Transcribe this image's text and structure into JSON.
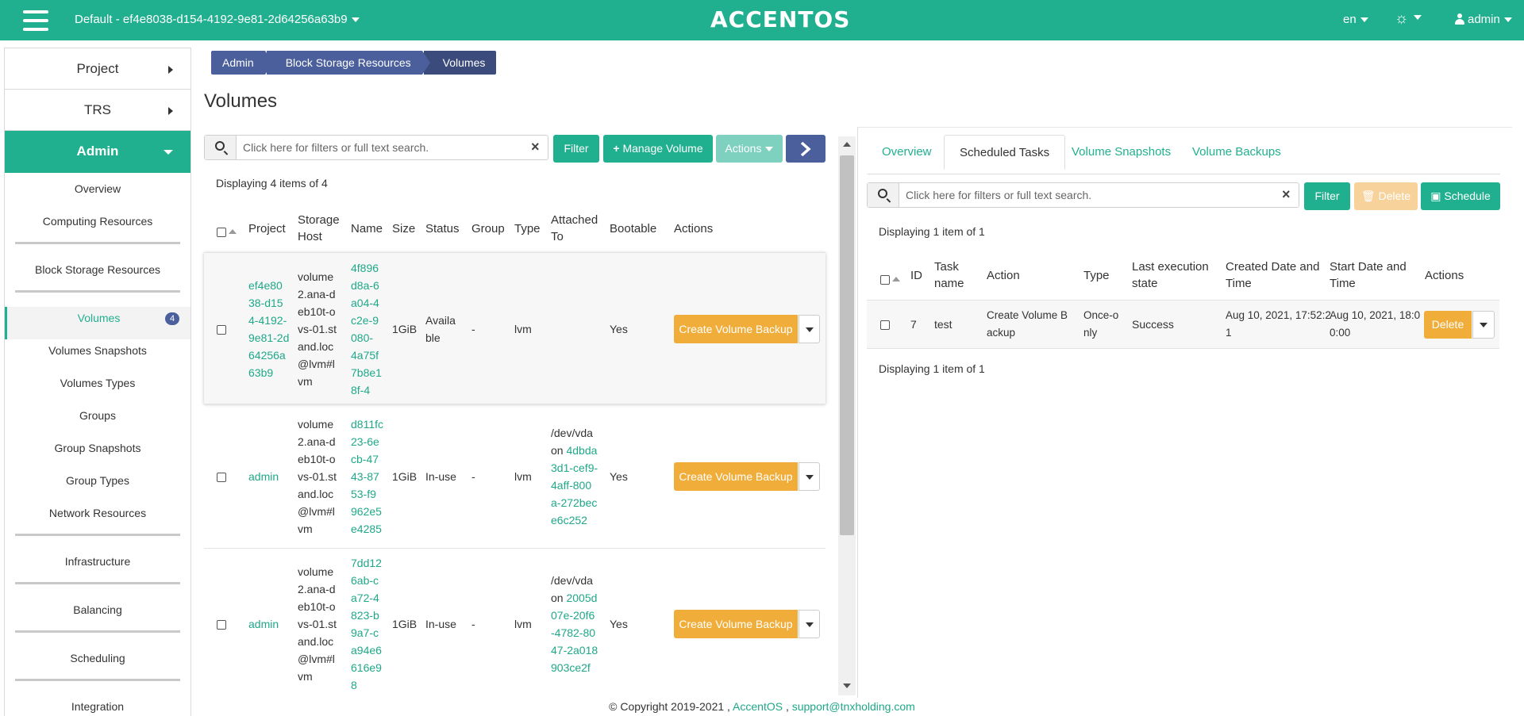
{
  "header": {
    "project_selector": "Default - ef4e8038-d154-4192-9e81-2d64256a63b9",
    "logo": "ACCENTOS",
    "language": "en",
    "user": "admin"
  },
  "sidebar": {
    "sections": [
      {
        "label": "Project"
      },
      {
        "label": "TRS"
      },
      {
        "label": "Admin"
      }
    ],
    "admin_items": [
      {
        "label": "Overview"
      },
      {
        "label": "Computing Resources"
      },
      {
        "label": "Block Storage Resources"
      },
      {
        "label": "Volumes",
        "badge": "4"
      },
      {
        "label": "Volumes Snapshots"
      },
      {
        "label": "Volumes Types"
      },
      {
        "label": "Groups"
      },
      {
        "label": "Group Snapshots"
      },
      {
        "label": "Group Types"
      },
      {
        "label": "Network Resources"
      },
      {
        "label": "Infrastructure"
      },
      {
        "label": "Balancing"
      },
      {
        "label": "Scheduling"
      },
      {
        "label": "Integration"
      }
    ]
  },
  "breadcrumb": [
    "Admin",
    "Block Storage Resources",
    "Volumes"
  ],
  "page_title": "Volumes",
  "volumes": {
    "search_placeholder": "Click here for filters or full text search.",
    "buttons": {
      "filter": "Filter",
      "manage": "Manage Volume",
      "actions": "Actions"
    },
    "display_info": "Displaying 4 items of 4",
    "columns": {
      "project": "Project",
      "storage_host_1": "Storage",
      "storage_host_2": "Host",
      "name": "Name",
      "size": "Size",
      "status": "Status",
      "group": "Group",
      "type": "Type",
      "attached_1": "Attached",
      "attached_2": "To",
      "bootable": "Bootable",
      "actions": "Actions"
    },
    "rows": [
      {
        "project": [
          "ef4e80",
          "38-d15",
          "4-4192-",
          "9e81-2d",
          "64256a",
          "63b9"
        ],
        "host": [
          "volume",
          "2.ana-d",
          "eb10t-o",
          "vs-01.st",
          "and.loc",
          "@lvm#l",
          "vm"
        ],
        "name": [
          "4f896",
          "d8a-6",
          "a04-4",
          "c2e-9",
          "080-",
          "4a75f",
          "7b8e1",
          "8f-4"
        ],
        "size": "1GiB",
        "status": [
          "Availa",
          "ble"
        ],
        "group": "-",
        "type": "lvm",
        "attached_prefix": [],
        "attached_link": [],
        "bootable": "Yes",
        "action": "Create Volume Backup"
      },
      {
        "project": [
          "admin"
        ],
        "host": [
          "volume",
          "2.ana-d",
          "eb10t-o",
          "vs-01.st",
          "and.loc",
          "@lvm#l",
          "vm"
        ],
        "name": [
          "d811fc",
          "23-6e",
          "cb-47",
          "43-87",
          "53-f9",
          "962e5",
          "e4285"
        ],
        "size": "1GiB",
        "status": [
          "In-use"
        ],
        "group": "-",
        "type": "lvm",
        "attached_prefix": [
          "/dev/vda",
          "on"
        ],
        "attached_link": [
          "4dbda",
          "3d1-cef9-",
          "4aff-800",
          "a-272bec",
          "e6c252"
        ],
        "bootable": "Yes",
        "action": "Create Volume Backup"
      },
      {
        "project": [
          "admin"
        ],
        "host": [
          "volume",
          "2.ana-d",
          "eb10t-o",
          "vs-01.st",
          "and.loc",
          "@lvm#l",
          "vm"
        ],
        "name": [
          "7dd12",
          "6ab-c",
          "a72-4",
          "823-b",
          "9a7-c",
          "a94e6",
          "616e9",
          "8"
        ],
        "size": "1GiB",
        "status": [
          "In-use"
        ],
        "group": "-",
        "type": "lvm",
        "attached_prefix": [
          "/dev/vda",
          "on"
        ],
        "attached_link": [
          "2005d",
          "07e-20f6",
          "-4782-80",
          "47-2a018",
          "903ce2f"
        ],
        "bootable": "Yes",
        "action": "Create Volume Backup"
      }
    ]
  },
  "detail": {
    "tabs": [
      "Overview",
      "Scheduled Tasks",
      "Volume Snapshots",
      "Volume Backups"
    ],
    "search_placeholder": "Click here for filters or full text search.",
    "buttons": {
      "filter": "Filter",
      "delete": "Delete",
      "schedule": "Schedule"
    },
    "display_info_top": "Displaying 1 item of 1",
    "display_info_bottom": "Displaying 1 item of 1",
    "columns": {
      "id": "ID",
      "task_1": "Task",
      "task_2": "name",
      "action": "Action",
      "type": "Type",
      "last_1": "Last execution",
      "last_2": "state",
      "created_1": "Created Date and",
      "created_2": "Time",
      "start_1": "Start Date and",
      "start_2": "Time",
      "actions": "Actions"
    },
    "row": {
      "id": "7",
      "name": "test",
      "action": [
        "Create Volume B",
        "ackup"
      ],
      "type": [
        "Once-o",
        "nly"
      ],
      "state": "Success",
      "created": [
        "Aug 10, 2021, 17:52:2",
        "1"
      ],
      "start": [
        "Aug 10, 2021, 18:0",
        "0:00"
      ],
      "delete": "Delete"
    }
  },
  "footer": {
    "copyright": "© Copyright 2019-2021 , ",
    "brand": "AccentOS",
    "sep": " , ",
    "email": "support@tnxholding.com"
  }
}
